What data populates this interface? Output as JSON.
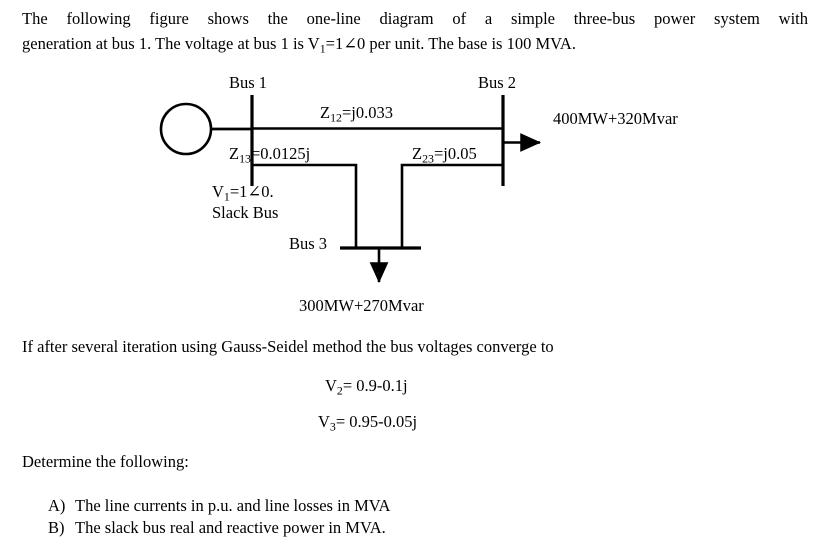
{
  "problem": {
    "intro_line1": "The following figure shows the one-line diagram of a simple three-bus power system with",
    "intro_line2_a": "generation at bus 1. The voltage at bus 1 is V",
    "intro_line2_sub": "1",
    "intro_line2_b": "=1∠0 per unit. The base is 100 MVA."
  },
  "diagram": {
    "bus1_label": "Bus 1",
    "bus2_label": "Bus 2",
    "bus3_label": "Bus 3",
    "z12_prefix": "Z",
    "z12_sub": "12",
    "z12_value": "=j0.033",
    "z13_prefix": "Z",
    "z13_sub": "13",
    "z13_value": "=0.0125j",
    "z23_prefix": "Z",
    "z23_sub": "23",
    "z23_value": "=j0.05",
    "v1_prefix": "V",
    "v1_sub": "1",
    "v1_value": "=1∠0.",
    "slack_label": "Slack Bus",
    "bus2_load": "400MW+320Mvar",
    "bus3_load": "300MW+270Mvar",
    "generator_icon": "generator-circle",
    "line_color": "#000000"
  },
  "converge": {
    "text": "If after several iteration using Gauss-Seidel method the bus voltages converge to",
    "v2_prefix": "V",
    "v2_sub": "2",
    "v2_value": "= 0.9-0.1j",
    "v3_prefix": "V",
    "v3_sub": "3",
    "v3_value": "= 0.95-0.05j"
  },
  "questions": {
    "heading": "Determine the following:",
    "items": [
      {
        "label": "A)",
        "text": "The line currents in p.u. and line losses in MVA"
      },
      {
        "label": "B)",
        "text": "The slack bus real and reactive power in MVA."
      }
    ]
  }
}
